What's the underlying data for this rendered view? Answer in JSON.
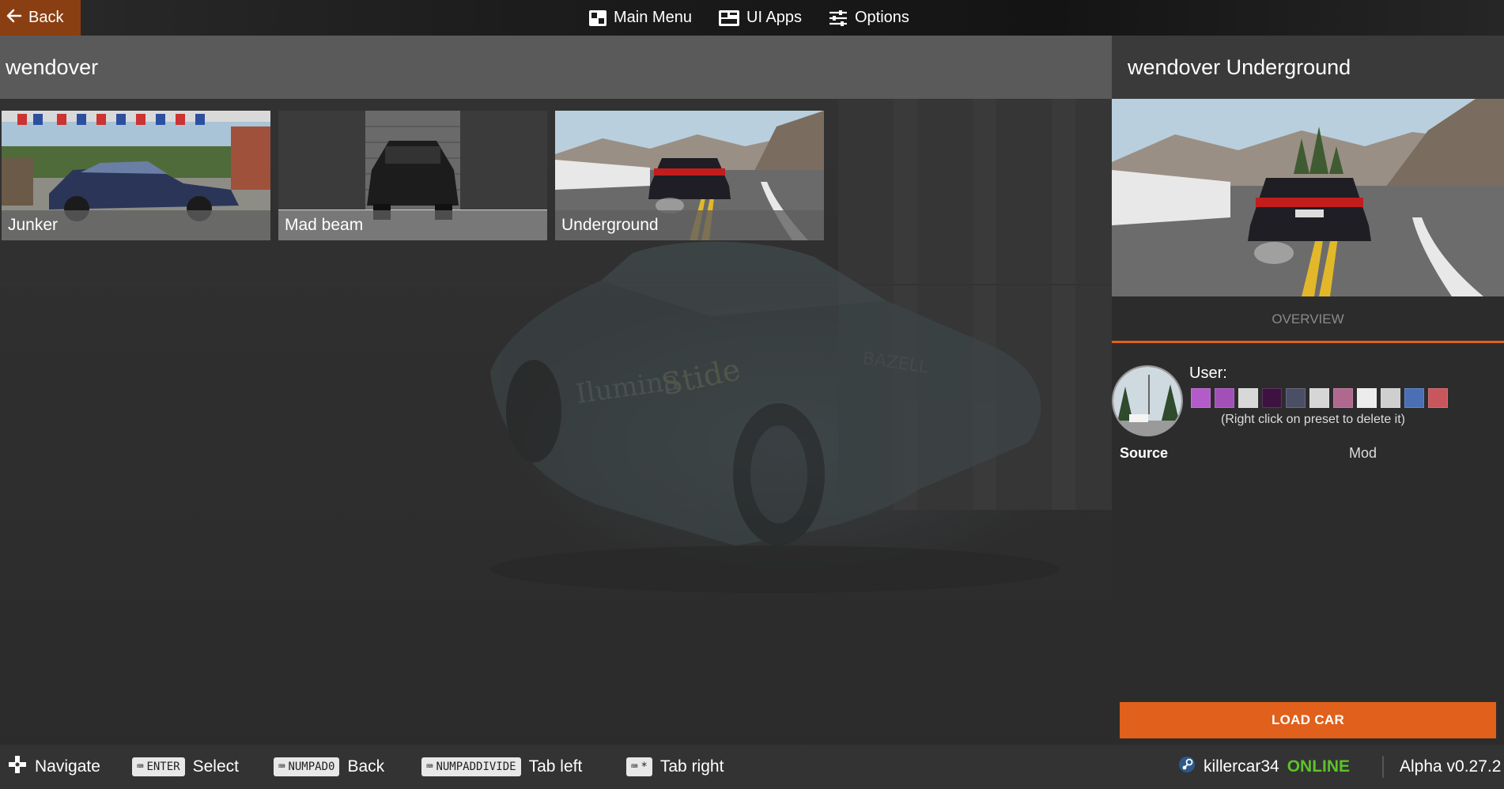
{
  "topbar": {
    "back_label": "Back",
    "nav": [
      {
        "label": "Main Menu",
        "icon": "main-menu-icon"
      },
      {
        "label": "UI Apps",
        "icon": "ui-apps-icon"
      },
      {
        "label": "Options",
        "icon": "options-icon"
      }
    ]
  },
  "left": {
    "header": "wendover",
    "tiles": [
      {
        "label": "Junker"
      },
      {
        "label": "Mad beam"
      },
      {
        "label": "Underground"
      }
    ]
  },
  "detail": {
    "title": "wendover Underground",
    "tab": "OVERVIEW",
    "user_label": "User:",
    "swatches": [
      "#b35bc8",
      "#a24fb8",
      "#d8d8d8",
      "#3d1240",
      "#4b4f66",
      "#d6d6d6",
      "#b0688f",
      "#ececec",
      "#cfcfcf",
      "#4a6fb5",
      "#c9565c"
    ],
    "hint": "(Right click on preset to delete it)",
    "source_label": "Source",
    "mod_label": "Mod",
    "load_button": "LOAD CAR"
  },
  "bottombar": {
    "hints": [
      {
        "key": "",
        "action": "Navigate",
        "icon": "gamepad-dpad-icon"
      },
      {
        "key": "ENTER",
        "action": "Select"
      },
      {
        "key": "NUMPAD0",
        "action": "Back"
      },
      {
        "key": "NUMPADDIVIDE",
        "action": "Tab left"
      },
      {
        "key": "*",
        "action": "Tab right"
      }
    ],
    "username": "killercar34",
    "status": "ONLINE",
    "version": "Alpha v0.27.2"
  },
  "colors": {
    "accent": "#e0601c",
    "online": "#5ec22a",
    "back_button": "#8a3f12"
  }
}
